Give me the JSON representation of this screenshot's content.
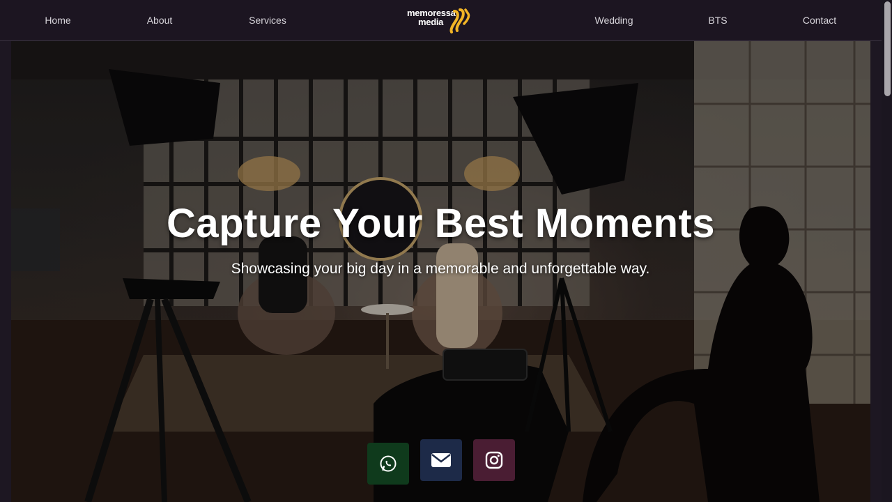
{
  "nav": {
    "left_links": [
      {
        "label": "Home"
      },
      {
        "label": "About"
      },
      {
        "label": "Services"
      }
    ],
    "right_links": [
      {
        "label": "Wedding"
      },
      {
        "label": "BTS"
      },
      {
        "label": "Contact"
      }
    ],
    "logo": {
      "line1": "memoressa",
      "line2": "media",
      "accent_color": "#f2b526"
    }
  },
  "hero": {
    "title": "Capture Your Best Moments",
    "subtitle": "Showcasing your big day in a memorable and unforgettable way."
  },
  "social": [
    {
      "icon": "whatsapp-icon",
      "color": "#0f3a1c"
    },
    {
      "icon": "envelope-icon",
      "color": "#1d2a48"
    },
    {
      "icon": "instagram-icon",
      "color": "#4a1d33"
    }
  ]
}
